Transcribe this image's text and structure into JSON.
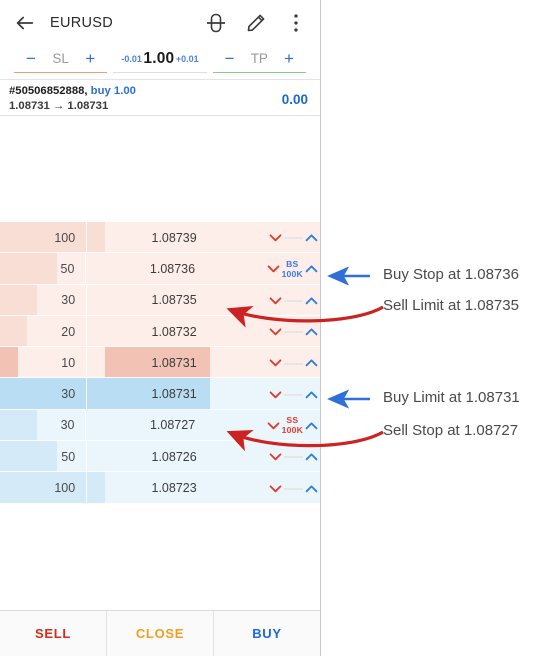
{
  "appbar": {
    "symbol": "EURUSD",
    "back_icon": "arrow-left-icon",
    "depth_icon": "depth-of-market-icon",
    "edit_icon": "pencil-icon",
    "menu_icon": "more-vertical-icon"
  },
  "controls": {
    "sl": {
      "minus": "−",
      "label": "SL",
      "plus": "+"
    },
    "volume": {
      "step_down": "-0.01",
      "value": "1.00",
      "step_up": "+0.01"
    },
    "tp": {
      "minus": "−",
      "label": "TP",
      "plus": "+"
    }
  },
  "position": {
    "ticket": "#50506852888,",
    "direction": " buy 1.00",
    "prices": "1.08731 → 1.08731",
    "profit": "0.00"
  },
  "book": {
    "rows": [
      {
        "volume": "100",
        "price": "1.08739",
        "side": "ask",
        "badge": "",
        "badge_kind": "dash",
        "bar_pct": 100,
        "best": false
      },
      {
        "volume": "50",
        "price": "1.08736",
        "side": "ask",
        "badge": "BS 100K",
        "badge_kind": "bs",
        "bar_pct": 50,
        "best": false
      },
      {
        "volume": "30",
        "price": "1.08735",
        "side": "ask",
        "badge": "",
        "badge_kind": "dash",
        "bar_pct": 30,
        "best": false
      },
      {
        "volume": "20",
        "price": "1.08732",
        "side": "ask",
        "badge": "",
        "badge_kind": "dash",
        "bar_pct": 20,
        "best": false
      },
      {
        "volume": "10",
        "price": "1.08731",
        "side": "ask",
        "badge": "",
        "badge_kind": "dash",
        "bar_pct": 10,
        "best": true
      },
      {
        "volume": "30",
        "price": "1.08731",
        "side": "bid",
        "badge": "",
        "badge_kind": "dash",
        "bar_pct": 30,
        "best": true
      },
      {
        "volume": "30",
        "price": "1.08727",
        "side": "bid",
        "badge": "SS 100K",
        "badge_kind": "ss",
        "bar_pct": 30,
        "best": false
      },
      {
        "volume": "50",
        "price": "1.08726",
        "side": "bid",
        "badge": "",
        "badge_kind": "dash",
        "bar_pct": 50,
        "best": false
      },
      {
        "volume": "100",
        "price": "1.08723",
        "side": "bid",
        "badge": "",
        "badge_kind": "dash",
        "bar_pct": 100,
        "best": false
      }
    ]
  },
  "actions": {
    "sell": "SELL",
    "close": "CLOSE",
    "buy": "BUY"
  },
  "annotations": [
    {
      "text": "Buy Stop at 1.08736",
      "kind": "straight",
      "color": "#2f6fd8"
    },
    {
      "text": "Sell Limit at 1.08735",
      "kind": "curved",
      "color": "#cc2222"
    },
    {
      "text": "Buy Limit at 1.08731",
      "kind": "straight",
      "color": "#2f6fd8"
    },
    {
      "text": "Sell Stop at 1.08727",
      "kind": "curved",
      "color": "#cc2222"
    }
  ],
  "colors": {
    "buy": "#2f6fd8",
    "sell": "#d42b1e",
    "close": "#f0a020",
    "ask_bar": "#f9ded6",
    "bid_bar": "#d5eaf8"
  }
}
